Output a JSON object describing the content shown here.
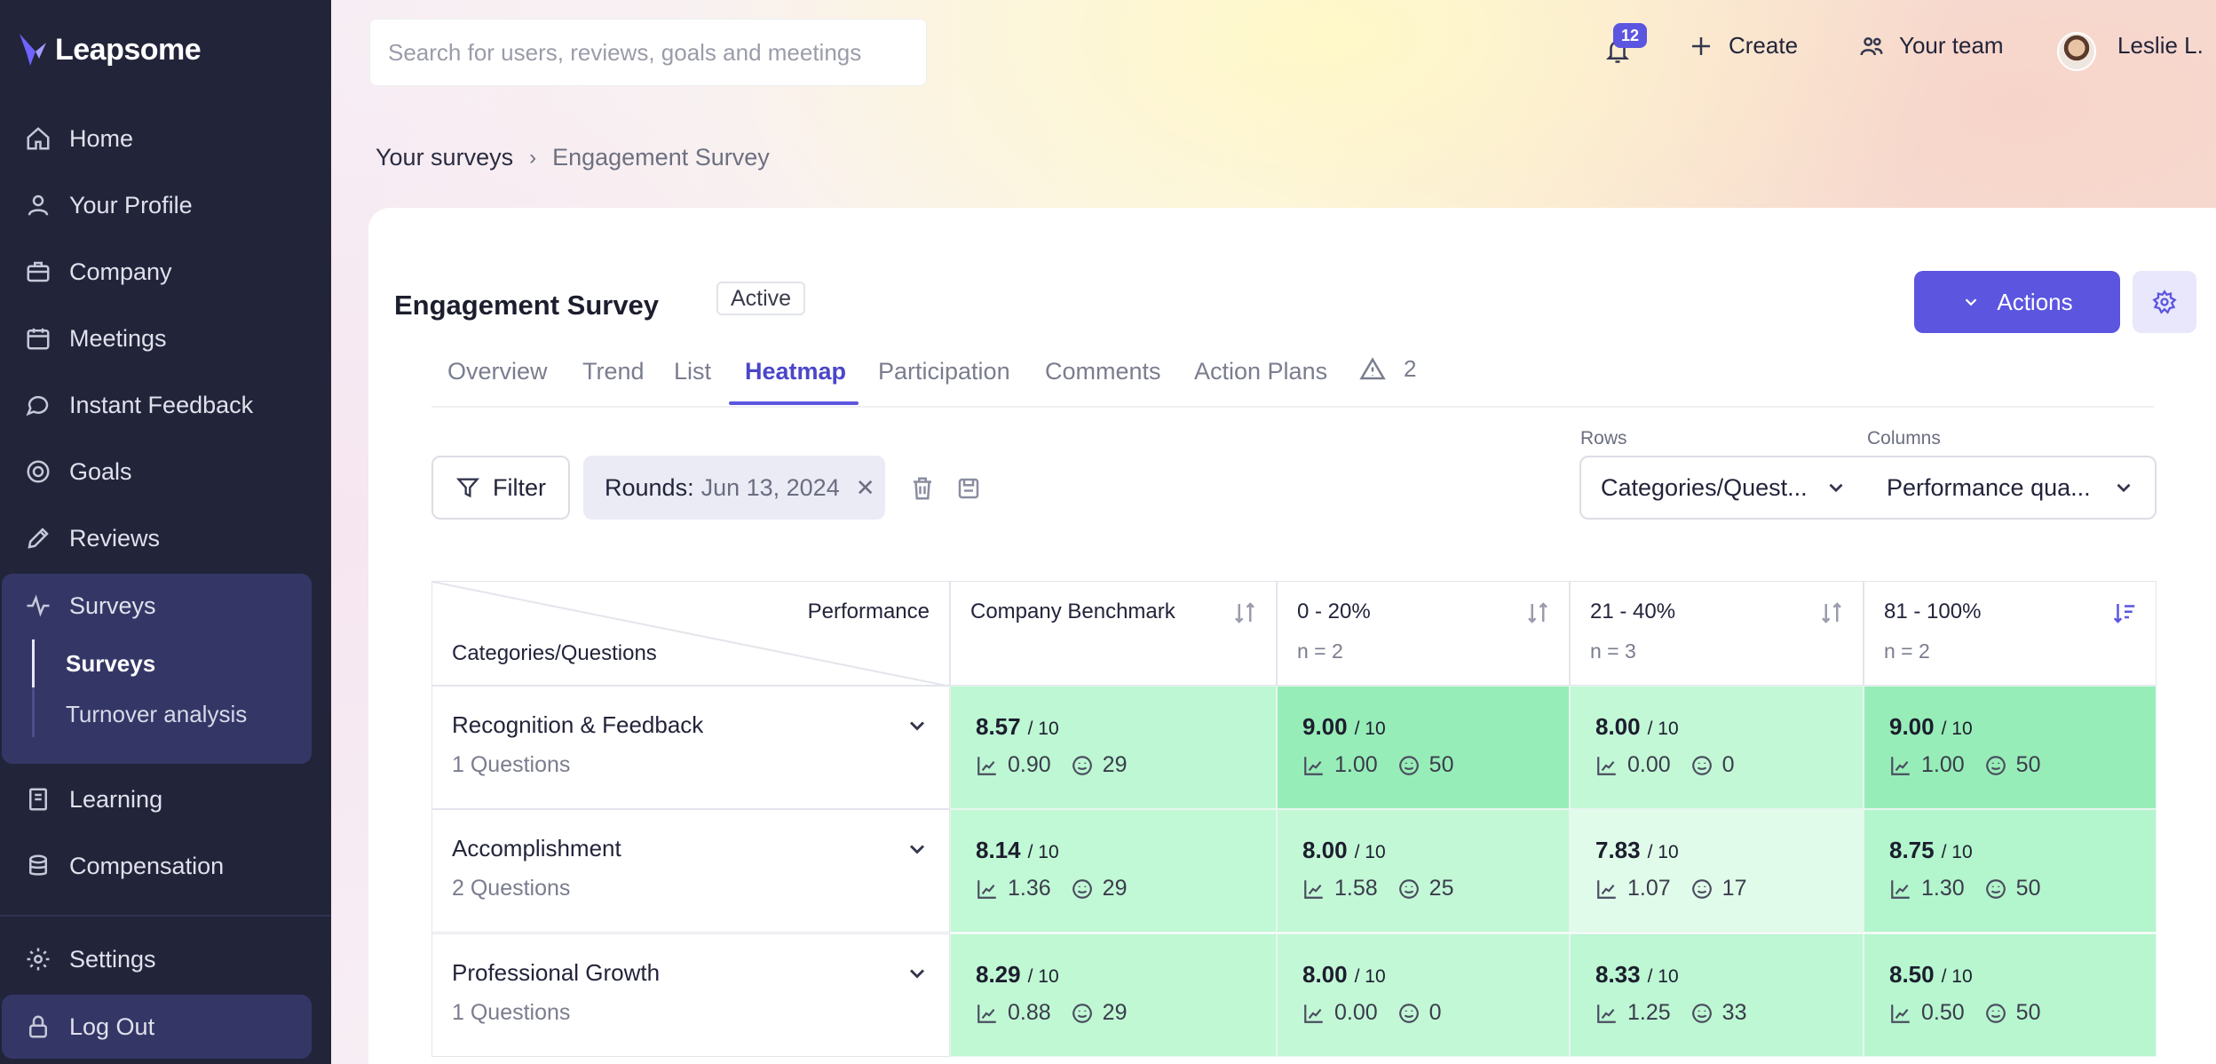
{
  "app": {
    "name": "Leapsome"
  },
  "sidebar": {
    "items": [
      {
        "label": "Home",
        "icon": "home-icon"
      },
      {
        "label": "Your Profile",
        "icon": "user-icon"
      },
      {
        "label": "Company",
        "icon": "briefcase-icon"
      },
      {
        "label": "Meetings",
        "icon": "calendar-icon"
      },
      {
        "label": "Instant Feedback",
        "icon": "chat-icon"
      },
      {
        "label": "Goals",
        "icon": "target-icon"
      },
      {
        "label": "Reviews",
        "icon": "pencil-icon"
      },
      {
        "label": "Surveys",
        "icon": "pulse-icon"
      },
      {
        "label": "Learning",
        "icon": "book-icon"
      },
      {
        "label": "Compensation",
        "icon": "coins-icon"
      },
      {
        "label": "Settings",
        "icon": "gear-icon"
      },
      {
        "label": "Log Out",
        "icon": "lock-icon"
      }
    ],
    "sub_items": [
      {
        "label": "Surveys",
        "active": true
      },
      {
        "label": "Turnover analysis",
        "active": false
      }
    ]
  },
  "topbar": {
    "search_placeholder": "Search for users, reviews, goals and meetings",
    "notification_count": "12",
    "create_label": "Create",
    "team_label": "Your team",
    "user_name": "Leslie L."
  },
  "breadcrumb": {
    "parent": "Your surveys",
    "current": "Engagement Survey"
  },
  "survey": {
    "title": "Engagement Survey",
    "status": "Active",
    "actions_label": "Actions",
    "tabs": [
      "Overview",
      "Trend",
      "List",
      "Heatmap",
      "Participation",
      "Comments",
      "Action Plans"
    ],
    "active_tab": "Heatmap",
    "warning_count": "2"
  },
  "filters": {
    "filter_label": "Filter",
    "chip_label": "Rounds:",
    "chip_value": "Jun 13, 2024",
    "rows_label": "Rows",
    "rows_value": "Categories/Quest...",
    "columns_label": "Columns",
    "columns_value": "Performance qua..."
  },
  "heatmap": {
    "corner_top": "Performance",
    "corner_bottom": "Categories/Questions",
    "max_suffix": "/ 10",
    "columns": [
      {
        "title": "Company Benchmark",
        "n": ""
      },
      {
        "title": "0 - 20%",
        "n": "n = 2"
      },
      {
        "title": "21 - 40%",
        "n": "n = 3"
      },
      {
        "title": "81 - 100%",
        "n": "n = 2"
      }
    ],
    "rows": [
      {
        "title": "Recognition & Feedback",
        "sub": "1 Questions",
        "cells": [
          {
            "score": "8.57",
            "dev": "0.90",
            "resp": "29",
            "color": "#bdf7d3"
          },
          {
            "score": "9.00",
            "dev": "1.00",
            "resp": "50",
            "color": "#97edb7"
          },
          {
            "score": "8.00",
            "dev": "0.00",
            "resp": "0",
            "color": "#c3f8d6"
          },
          {
            "score": "9.00",
            "dev": "1.00",
            "resp": "50",
            "color": "#97edb7"
          }
        ]
      },
      {
        "title": "Accomplishment",
        "sub": "2 Questions",
        "cells": [
          {
            "score": "8.14",
            "dev": "1.36",
            "resp": "29",
            "color": "#c1f8d5"
          },
          {
            "score": "8.00",
            "dev": "1.58",
            "resp": "25",
            "color": "#c3f8d6"
          },
          {
            "score": "7.83",
            "dev": "1.07",
            "resp": "17",
            "color": "#e0fbe9"
          },
          {
            "score": "8.75",
            "dev": "1.30",
            "resp": "50",
            "color": "#b3f5cc"
          }
        ]
      },
      {
        "title": "Professional Growth",
        "sub": "1 Questions",
        "cells": [
          {
            "score": "8.29",
            "dev": "0.88",
            "resp": "29",
            "color": "#c0f8d4"
          },
          {
            "score": "8.00",
            "dev": "0.00",
            "resp": "0",
            "color": "#c3f8d6"
          },
          {
            "score": "8.33",
            "dev": "1.25",
            "resp": "33",
            "color": "#bdf7d3"
          },
          {
            "score": "8.50",
            "dev": "0.50",
            "resp": "50",
            "color": "#b7f6cf"
          }
        ]
      }
    ]
  }
}
